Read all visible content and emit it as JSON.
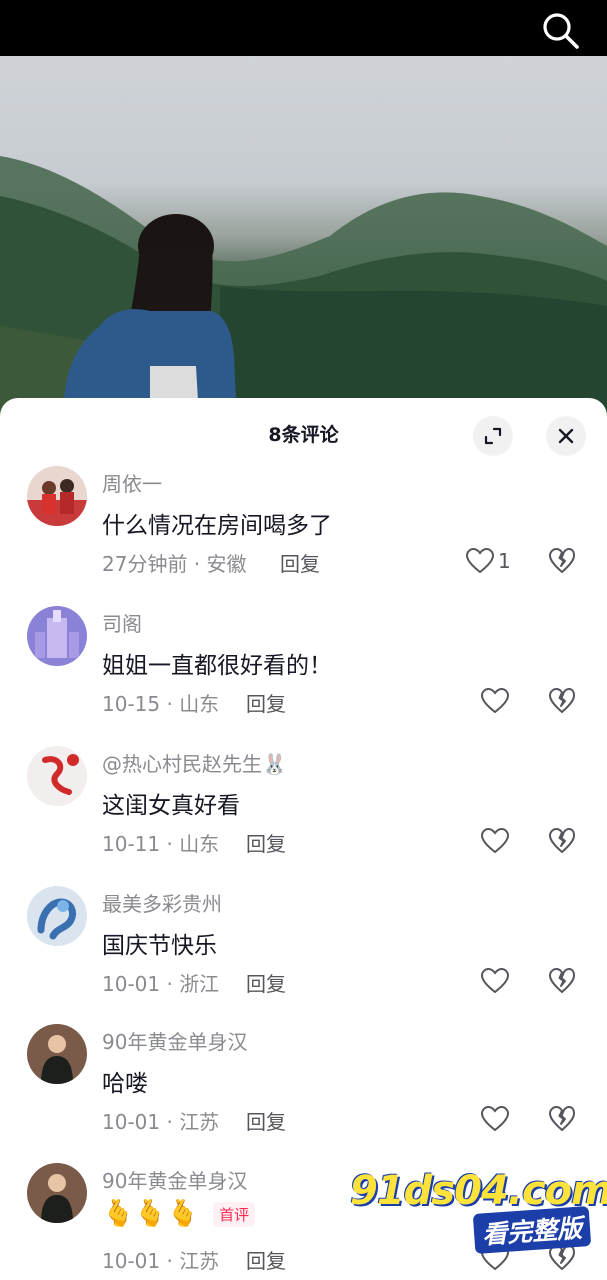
{
  "colors": {
    "accent": "#fe2c55",
    "text": "#161823",
    "muted": "#8a8b91"
  },
  "sheet": {
    "title": "8条评论"
  },
  "comments": [
    {
      "username": "周依一",
      "text": "什么情况在房间喝多了",
      "meta": "27分钟前 · 安徽",
      "reply": "回复",
      "likes": "1"
    },
    {
      "username": "司阁",
      "text": "姐姐一直都很好看的！",
      "meta": "10-15 · 山东",
      "reply": "回复",
      "likes": ""
    },
    {
      "username": "@热心村民赵先生🐰",
      "text": "这闺女真好看",
      "meta": "10-11 · 山东",
      "reply": "回复",
      "likes": ""
    },
    {
      "username": "最美多彩贵州",
      "text": "国庆节快乐",
      "meta": "10-01 · 浙江",
      "reply": "回复",
      "likes": ""
    },
    {
      "username": "90年黄金单身汉",
      "text": "哈喽",
      "meta": "10-01 · 江苏",
      "reply": "回复",
      "likes": ""
    },
    {
      "username": "90年黄金单身汉",
      "emoji": "🫰🫰🫰",
      "badge": "首评",
      "meta": "10-01 · 江苏",
      "reply": "回复",
      "likes": ""
    }
  ],
  "watermark": {
    "site": "91ds04.com",
    "tagline": "看完整版"
  },
  "icons": [
    "search-icon",
    "expand-icon",
    "close-icon",
    "heart-icon",
    "broken-heart-icon"
  ]
}
